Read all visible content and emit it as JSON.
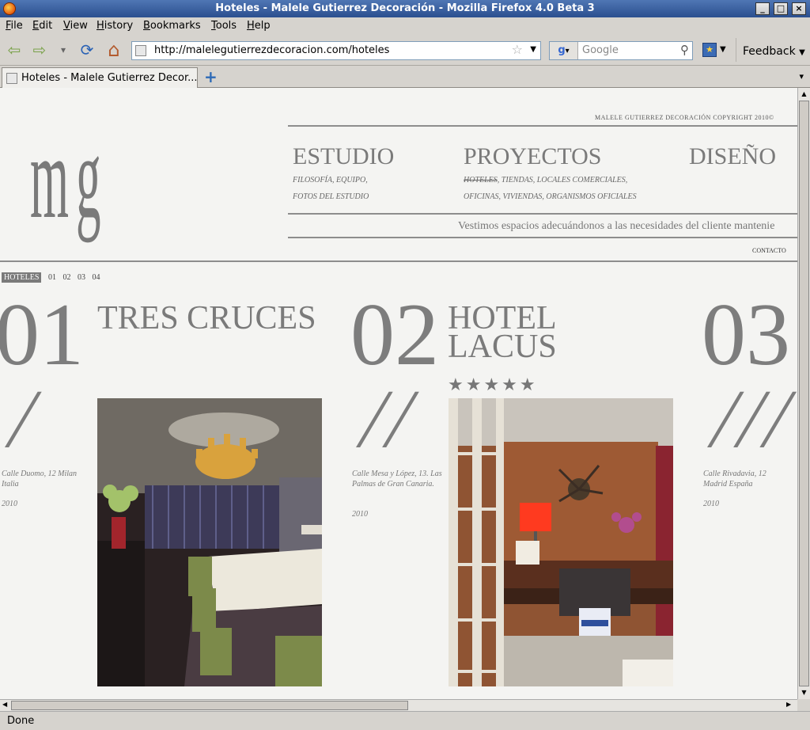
{
  "window": {
    "title": "Hoteles - Malele Gutierrez Decoración - Mozilla Firefox 4.0 Beta 3",
    "min": "_",
    "max": "□",
    "close": "×"
  },
  "menu": [
    "File",
    "Edit",
    "View",
    "History",
    "Bookmarks",
    "Tools",
    "Help"
  ],
  "toolbar": {
    "back": "⇦",
    "forward": "⇨",
    "history": "▾",
    "reload": "⟳",
    "home": "⌂",
    "url": "http://malelegutierrezdecoracion.com/hoteles",
    "search_placeholder": "Google",
    "feedback": "Feedback"
  },
  "tab": {
    "title": "Hoteles - Malele Gutierrez Decor...",
    "new_tab": "+",
    "list": "▾"
  },
  "site": {
    "logo": "m g",
    "copyright": "MALELE GUTIERREZ DECORACIÓN COPYRIGHT 2010©",
    "nav": [
      {
        "label": "ESTUDIO",
        "sub1": "FILOSOFÍA, EQUIPO,",
        "sub2": "FOTOS DEL ESTUDIO"
      },
      {
        "label": "PROYECTOS",
        "sub_active": "HOTELES",
        "sub1": ", TIENDAS, LOCALES COMERCIALES,",
        "sub2": "OFICINAS, VIVIENDAS, ORGANISMOS OFICIALES"
      },
      {
        "label": "DISEÑO"
      }
    ],
    "slogan": "Vestimos espacios adecuándonos a las necesidades del cliente mantenie",
    "contact": "CONTACTO",
    "subnav": {
      "active": "HOTELES",
      "items": [
        "01",
        "02",
        "03",
        "04"
      ]
    },
    "hotels": [
      {
        "num": "01",
        "name_l1": "TRES CRUCES",
        "name_l2": "",
        "slash": "/",
        "addr": "Calle Duomo, 12 Milan Italia",
        "year": "2010"
      },
      {
        "num": "02",
        "name_l1": "HOTEL",
        "name_l2": "LACUS",
        "stars": "★★★★★",
        "slash": "//",
        "addr": "Calle Mesa y López, 13. Las Palmas de Gran Canaria.",
        "year": "2010"
      },
      {
        "num": "03",
        "name_l1": "",
        "name_l2": "",
        "slash": "///",
        "addr": "Calle Rivadavia, 12 Madrid España",
        "year": "2010"
      }
    ]
  },
  "statusbar": "Done"
}
